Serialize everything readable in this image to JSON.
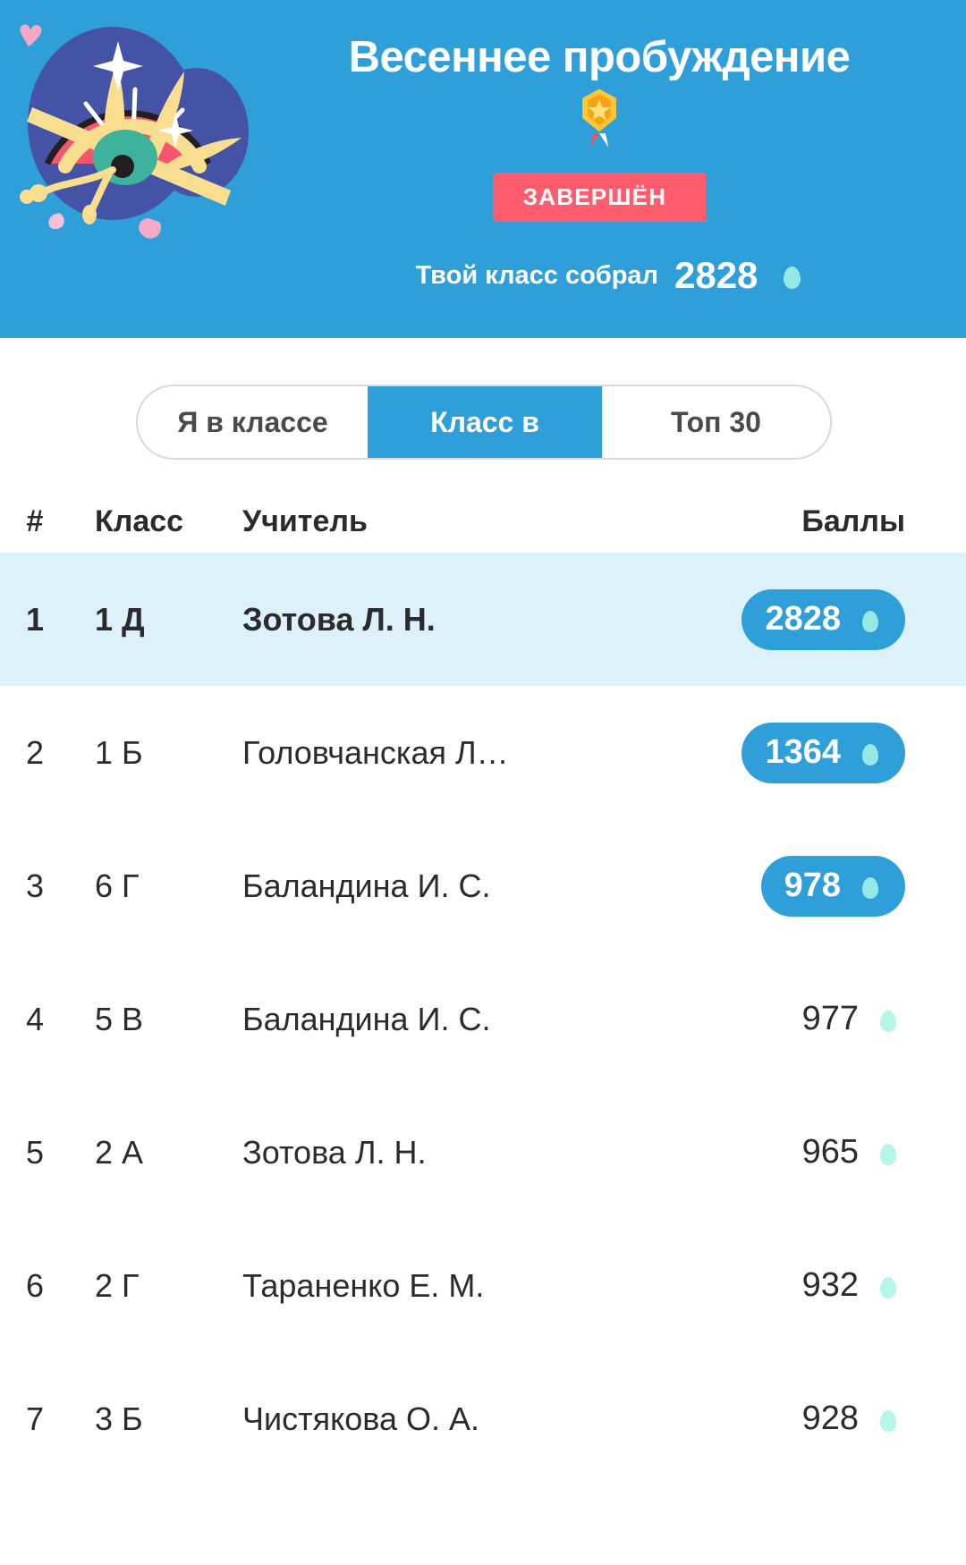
{
  "banner": {
    "title": "Весеннее пробуждение",
    "status_badge": "ЗАВЕРШЁН",
    "collected_label": "Твой класс собрал",
    "collected_value": "2828",
    "icons": {
      "illustration": "spring-fan-illustration",
      "medal": "gold-medal-icon",
      "currency": "teal-egg-icon"
    },
    "colors": {
      "background": "#2E9FD8",
      "badge": "#FF5D6E",
      "egg": "#3BE3C8",
      "medal_gold": "#FFC734"
    }
  },
  "tabs": {
    "items": [
      {
        "label": "Я в классе",
        "active": false
      },
      {
        "label": "Класс в",
        "active": true
      },
      {
        "label": "Топ 30",
        "active": false
      }
    ]
  },
  "table": {
    "headers": {
      "rank": "#",
      "class": "Класс",
      "teacher": "Учитель",
      "score": "Баллы"
    },
    "rows": [
      {
        "rank": "1",
        "class": "1 Д",
        "teacher": "Зотова Л. Н.",
        "score": "2828",
        "pill": true,
        "highlight": true
      },
      {
        "rank": "2",
        "class": "1 Б",
        "teacher": "Головчанская Л…",
        "score": "1364",
        "pill": true,
        "highlight": false
      },
      {
        "rank": "3",
        "class": "6 Г",
        "teacher": "Баландина И. С.",
        "score": "978",
        "pill": true,
        "highlight": false
      },
      {
        "rank": "4",
        "class": "5 В",
        "teacher": "Баландина И. С.",
        "score": "977",
        "pill": false,
        "highlight": false
      },
      {
        "rank": "5",
        "class": "2 А",
        "teacher": "Зотова Л. Н.",
        "score": "965",
        "pill": false,
        "highlight": false
      },
      {
        "rank": "6",
        "class": "2 Г",
        "teacher": "Тараненко Е. М.",
        "score": "932",
        "pill": false,
        "highlight": false
      },
      {
        "rank": "7",
        "class": "3 Б",
        "teacher": "Чистякова О. А.",
        "score": "928",
        "pill": false,
        "highlight": false
      }
    ]
  }
}
